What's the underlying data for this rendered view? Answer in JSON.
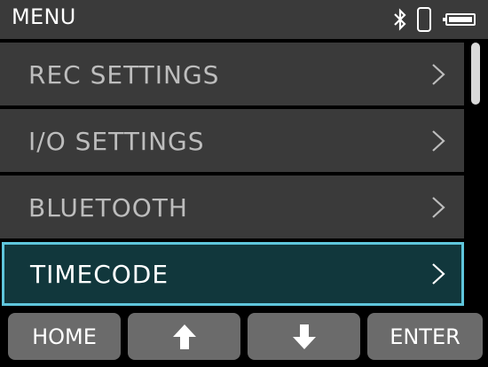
{
  "header": {
    "title": "MENU",
    "icons": [
      "bluetooth-icon",
      "smartphone-icon",
      "battery-icon"
    ]
  },
  "menu": {
    "items": [
      {
        "label": "REC SETTINGS",
        "selected": false
      },
      {
        "label": "I/O SETTINGS",
        "selected": false
      },
      {
        "label": "BLUETOOTH",
        "selected": false
      },
      {
        "label": "TIMECODE",
        "selected": true
      }
    ]
  },
  "footer": {
    "home_label": "HOME",
    "up_icon": "arrow-up-icon",
    "down_icon": "arrow-down-icon",
    "enter_label": "ENTER"
  },
  "colors": {
    "background": "#000000",
    "header_bg": "#3a3a3a",
    "item_bg": "#3a3a3a",
    "selected_bg": "#11373c",
    "selected_border": "#5fc6dc",
    "button_bg": "#6b6b6b",
    "text": "#ffffff",
    "item_text": "#bdbdbd"
  }
}
